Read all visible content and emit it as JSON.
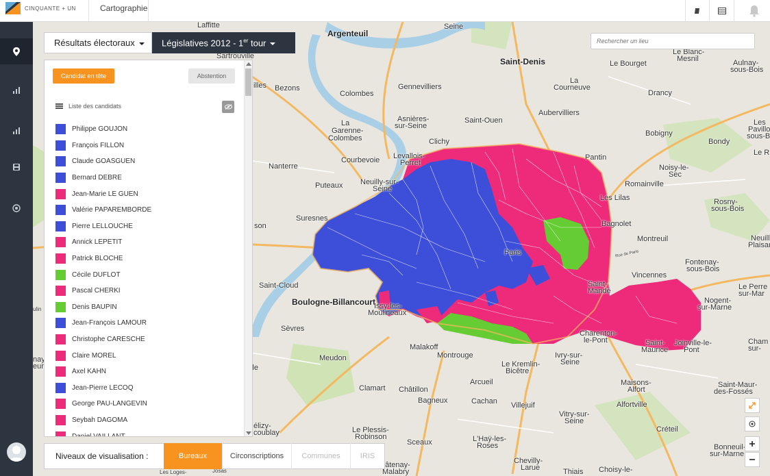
{
  "brand": "CINQUANTE + UN",
  "app_title": "Cartographie",
  "search": {
    "placeholder": "Rechercher un lieu"
  },
  "dropdowns": {
    "dataset": "Résultats électoraux",
    "election": "Législatives 2012 - 1",
    "election_sup": "er",
    "election_suffix": " tour"
  },
  "panel": {
    "btn_lead": "Candidat en tête",
    "btn_abstention": "Abstention",
    "list_title": "Liste des candidats",
    "candidates": [
      {
        "name": "Philippe GOUJON",
        "color": "#3d4fd8"
      },
      {
        "name": "François FILLON",
        "color": "#3d4fd8"
      },
      {
        "name": "Claude GOASGUEN",
        "color": "#3d4fd8"
      },
      {
        "name": "Bernard DEBRE",
        "color": "#3d4fd8"
      },
      {
        "name": "Jean-Marie LE GUEN",
        "color": "#ee2a7b"
      },
      {
        "name": "Valérie PAPAREMBORDE",
        "color": "#3d4fd8"
      },
      {
        "name": "Pierre LELLOUCHE",
        "color": "#3d4fd8"
      },
      {
        "name": "Annick LEPETIT",
        "color": "#ee2a7b"
      },
      {
        "name": "Patrick BLOCHE",
        "color": "#ee2a7b"
      },
      {
        "name": "Cécile DUFLOT",
        "color": "#66cc33"
      },
      {
        "name": "Pascal CHERKI",
        "color": "#ee2a7b"
      },
      {
        "name": "Denis BAUPIN",
        "color": "#66cc33"
      },
      {
        "name": "Jean-François LAMOUR",
        "color": "#3d4fd8"
      },
      {
        "name": "Christophe CARESCHE",
        "color": "#ee2a7b"
      },
      {
        "name": "Claire MOREL",
        "color": "#ee2a7b"
      },
      {
        "name": "Axel KAHN",
        "color": "#ee2a7b"
      },
      {
        "name": "Jean-Pierre LECOQ",
        "color": "#3d4fd8"
      },
      {
        "name": "George PAU-LANGEVIN",
        "color": "#ee2a7b"
      },
      {
        "name": "Seybah DAGOMA",
        "color": "#ee2a7b"
      },
      {
        "name": "Daniel VAILLANT",
        "color": "#ee2a7b"
      }
    ]
  },
  "levels": {
    "label": "Niveaux de visualisation :",
    "items": [
      "Bureaux",
      "Circonscriptions",
      "Communes",
      "IRIS"
    ],
    "active": "Bureaux"
  },
  "map_places": [
    "Laffitte",
    "Argenteuil",
    "Seine",
    "Sartrouville",
    "Saint-Denis",
    "Le Bourget",
    "Le Blanc-",
    "Mesnil",
    "Aulnay-",
    "sous-Bois",
    "illes",
    "Bezons",
    "Colombes",
    "Gennevilliers",
    "La",
    "Courneuve",
    "Drancy",
    "Aubervilliers",
    "La",
    "Garenne-",
    "Colombes",
    "Asnières-",
    "sur-Seine",
    "Saint-Ouen",
    "Clichy",
    "Bobigny",
    "Bondy",
    "Les",
    "Pavillons-",
    "sous-Bois",
    "Le R",
    "Nanterre",
    "Courbevoie",
    "Levallois-",
    "Perret",
    "Pantin",
    "Noisy-le-",
    "Sec",
    "Romainville",
    "Puteaux",
    "Neuilly-sur-",
    "Seine",
    "Les Lilas",
    "Rosny-",
    "sous-Bois",
    "Suresnes",
    "son",
    "Bagnolet",
    "Montreuil",
    "Neuill",
    "Plaisan",
    "Paris",
    "Fontenay-",
    "sous-Bois",
    "Saint-Cloud",
    "Vincennes",
    "Le Perre",
    "sur-Mar",
    "Boulogne-Billancourt",
    "Saint-",
    "Mandé",
    "Nogent-",
    "sur-Marne",
    "Issy-les-",
    "Moulineaux",
    "Sèvres",
    "Charenton-",
    "le-Pont",
    "Saint-",
    "Maurice",
    "Joinville-le-",
    "Pont",
    "Cham",
    "sur-",
    "Malakoff",
    "Montrouge",
    "Meudon",
    "Le Kremlin-",
    "Bicêtre",
    "Ivry-sur-",
    "Seine",
    "ville",
    "Arcueil",
    "Maisons-",
    "Alfort",
    "Saint-Maur-",
    "des-Fossés",
    "Clamart",
    "Châtillon",
    "Bagneux",
    "Cachan",
    "Villejuif",
    "Alfortville",
    "Vitry-sur-",
    "Seine",
    "Créteil",
    "Le Plessis-",
    "Robinson",
    "Sceaux",
    "L'Haÿ-les-",
    "Roses",
    "Bonneuil-",
    "sur-Marne",
    "Chevilly-",
    "Larue",
    "Thiais",
    "Choisy-le-",
    "élizy-",
    "coublay",
    "Les Loges-",
    "Josas",
    "hâtenay-",
    "Malabry",
    "ulin",
    "nay",
    "eury",
    "Rue de Paris"
  ]
}
